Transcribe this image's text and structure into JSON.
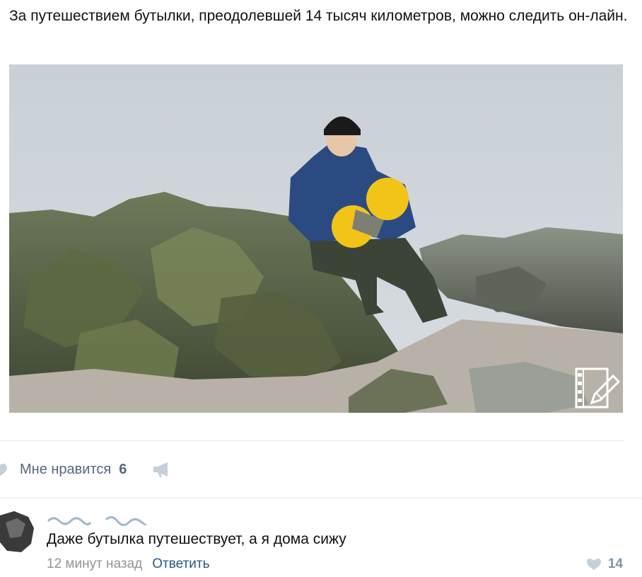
{
  "post": {
    "text": "За путешествием бутылки, преодолевшей 14 тысяч километров, можно следить он-лайн.",
    "media_icon": "video-edit-icon"
  },
  "actions": {
    "like_label": "Мне нравится",
    "like_count": "6",
    "share_icon": "megaphone-icon"
  },
  "comment": {
    "author": "",
    "text": "Даже бутылка путешествует, а я дома сижу",
    "time": "12 минут назад",
    "reply_label": "Ответить",
    "like_count": "14"
  },
  "colors": {
    "link": "#2a5885",
    "muted": "#939393",
    "action": "#55677d"
  }
}
